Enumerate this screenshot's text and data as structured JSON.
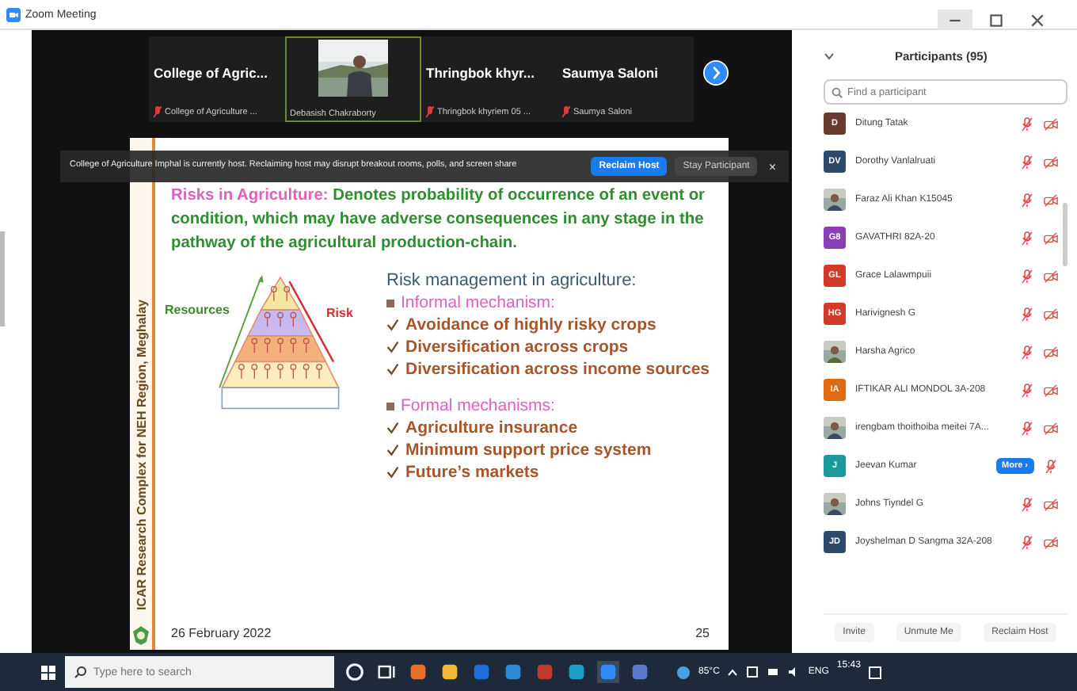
{
  "window": {
    "title": "Zoom Meeting"
  },
  "thumbnails": [
    {
      "kind": "name",
      "title": "College of Agric...",
      "caption": "College of Agriculture ...",
      "muted": true,
      "selected": false
    },
    {
      "kind": "video",
      "caption": "Debasish Chakraborty",
      "muted": false,
      "selected": true
    },
    {
      "kind": "name",
      "title": "Thringbok  khyr...",
      "caption": "Thringbok khyriem 05 ...",
      "muted": true,
      "selected": false
    },
    {
      "kind": "name",
      "title": "Saumya Saloni",
      "caption": "Saumya Saloni",
      "muted": true,
      "selected": false
    }
  ],
  "banner": {
    "message": "College of Agriculture Imphal is currently host. Reclaiming host may disrupt breakout rooms, polls, and screen share",
    "primary": "Reclaim Host",
    "secondary": "Stay Participant",
    "close": "×"
  },
  "slide": {
    "side_text": "ICAR Research Complex for NEH Region, Meghalay",
    "definition": {
      "term": "Risks in Agriculture:",
      "text": " Denotes probability of occurrence of an event or condition, which may have adverse consequences in any stage in the pathway of the agricultural production-chain."
    },
    "pyramid": {
      "left_label": "Resources",
      "right_label": "Risk"
    },
    "heading": "Risk management in agriculture:",
    "sections": [
      {
        "title": "Informal mechanism:",
        "items": [
          "Avoidance of highly risky crops",
          "Diversification across crops",
          "Diversification across income sources"
        ]
      },
      {
        "title": "Formal mechanisms:",
        "items": [
          "Agriculture insurance",
          "Minimum support price system",
          "Future’s markets"
        ]
      }
    ],
    "date": "26 February 2022",
    "page": "25"
  },
  "participants_panel": {
    "title": "Participants (95)",
    "search": {
      "placeholder": "Find a participant"
    },
    "participants": [
      {
        "kind": "initials",
        "initials": "D",
        "color": "#6b3a2e",
        "name": "Ditung Tatak",
        "hovered": false
      },
      {
        "kind": "initials",
        "initials": "DV",
        "color": "#2c4a6b",
        "name": "Dorothy Vanlalruati",
        "hovered": false
      },
      {
        "kind": "picture",
        "name": "Faraz Ali Khan K15045",
        "hovered": false
      },
      {
        "kind": "initials",
        "initials": "G8",
        "color": "#8a3fb8",
        "name": "GAVATHRI 82A-20",
        "hovered": false
      },
      {
        "kind": "initials",
        "initials": "GL",
        "color": "#d23a2a",
        "name": "Grace Lalawmpuii",
        "hovered": false
      },
      {
        "kind": "initials",
        "initials": "HG",
        "color": "#d23a2a",
        "name": "Harivignesh G",
        "hovered": false
      },
      {
        "kind": "picture",
        "name": "Harsha Agrico",
        "hovered": false
      },
      {
        "kind": "initials",
        "initials": "IA",
        "color": "#e06a10",
        "name": "IFTIKAR ALI MONDOL 3A-208",
        "hovered": false
      },
      {
        "kind": "picture",
        "name": "irengbam thoithoiba meitei 7A...",
        "hovered": false
      },
      {
        "kind": "initials",
        "initials": "J",
        "color": "#1a9a9a",
        "name": "Jeevan Kumar",
        "hovered": true
      },
      {
        "kind": "picture",
        "name": "Johns Tiyndel G",
        "hovered": false
      },
      {
        "kind": "initials",
        "initials": "JD",
        "color": "#2c4a6b",
        "name": "Joyshelman D Sangma 32A-208",
        "hovered": false
      }
    ],
    "more": "More ›",
    "buttons": [
      "Invite",
      "Unmute Me",
      "Reclaim Host"
    ]
  },
  "taskbar": {
    "search": {
      "placeholder": "Type here to search"
    },
    "temperature": "85°C",
    "language": "ENG",
    "time": "15:43"
  }
}
